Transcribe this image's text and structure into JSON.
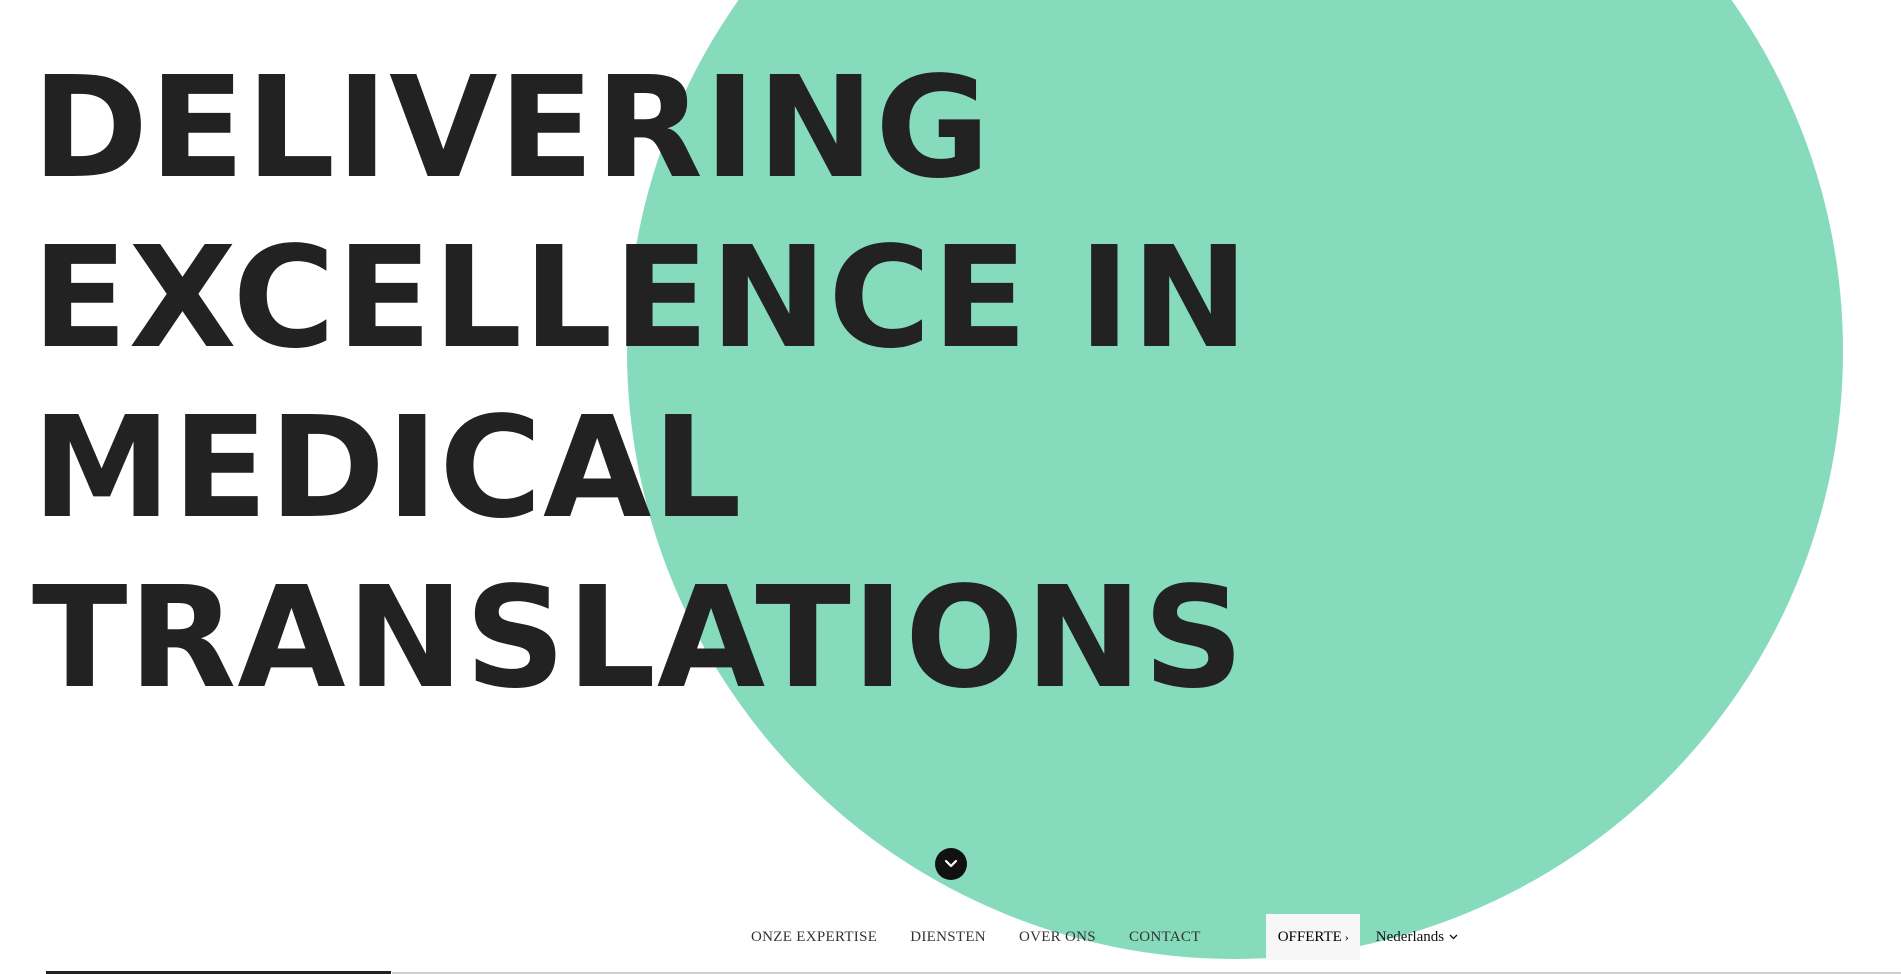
{
  "hero": {
    "headline_lines": [
      "DELIVERING",
      "EXCELLENCE IN",
      "MEDICAL",
      "TRANSLATIONS"
    ]
  },
  "scroll_icon": "chevron-down-icon",
  "nav": {
    "items": [
      "ONZE EXPERTISE",
      "DIENSTEN",
      "OVER ONS",
      "CONTACT"
    ],
    "quote_label": "OFFERTE",
    "quote_chevron": "›",
    "language": "Nederlands"
  },
  "colors": {
    "circle": "#86dbbc",
    "headline": "#222222",
    "background": "#ffffff"
  }
}
